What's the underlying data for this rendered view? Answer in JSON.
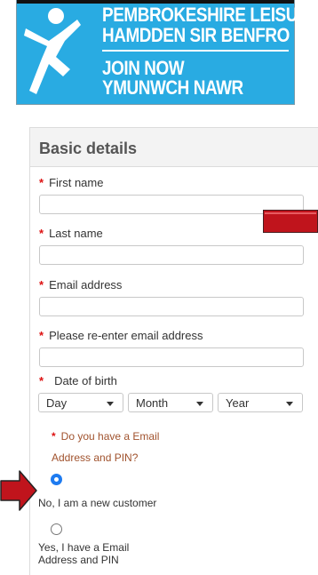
{
  "banner": {
    "line1": "PEMBROKESHIRE LEISURE",
    "line2": "HAMDDEN SIR BENFRO",
    "line3": "JOIN NOW",
    "line4": "YMUNWCH NAWR",
    "bg_color": "#29ABE2",
    "logo_icon": "running-figure-icon"
  },
  "form": {
    "section_title": "Basic details",
    "required_marker": "*",
    "first_name": {
      "label": "First name",
      "value": ""
    },
    "last_name": {
      "label": "Last name",
      "value": ""
    },
    "email": {
      "label": "Email address",
      "value": ""
    },
    "email_confirm": {
      "label": "Please re-enter email address",
      "value": ""
    },
    "dob": {
      "label": "Date of birth",
      "day": "Day",
      "month": "Month",
      "year": "Year"
    },
    "question": {
      "line1": "Do you have a Email",
      "line2": "Address and PIN?"
    },
    "options": [
      {
        "label": "No, I am a new customer",
        "selected": true
      },
      {
        "label_line1": "Yes, I have a Email",
        "label_line2": "Address and PIN",
        "selected": false
      }
    ]
  },
  "annotations": {
    "arrow_color": "#c0141c",
    "arrow_icon": "pointer-arrow-icon"
  }
}
